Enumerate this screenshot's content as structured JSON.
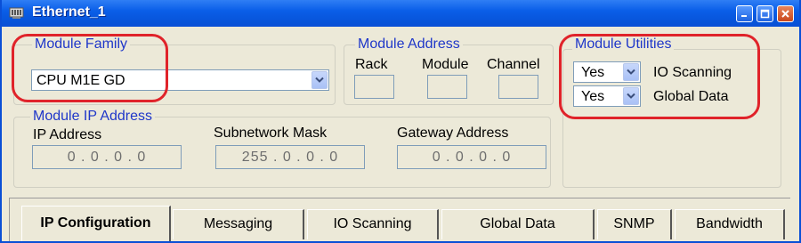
{
  "window": {
    "title": "Ethernet_1"
  },
  "module_family": {
    "title": "Module Family",
    "value": "CPU M1E GD"
  },
  "module_address": {
    "title": "Module Address",
    "rack_label": "Rack",
    "module_label": "Module",
    "channel_label": "Channel"
  },
  "module_utilities": {
    "title": "Module Utilities",
    "io_scanning_value": "Yes",
    "io_scanning_label": "IO Scanning",
    "global_data_value": "Yes",
    "global_data_label": "Global Data"
  },
  "module_ip": {
    "title": "Module IP Address",
    "ip_label": "IP Address",
    "ip_value": "0 . 0 . 0 . 0",
    "subnet_label": "Subnetwork Mask",
    "subnet_value": "255 . 0 . 0 . 0",
    "gateway_label": "Gateway Address",
    "gateway_value": "0 . 0 . 0 . 0"
  },
  "tabs": [
    {
      "label": "IP Configuration",
      "active": true
    },
    {
      "label": "Messaging"
    },
    {
      "label": "IO Scanning"
    },
    {
      "label": "Global Data"
    },
    {
      "label": "SNMP"
    },
    {
      "label": "Bandwidth"
    }
  ],
  "colors": {
    "group_title": "#1f37c9",
    "highlight_ring": "#e0232a",
    "titlebar": "#0a5ee8"
  }
}
